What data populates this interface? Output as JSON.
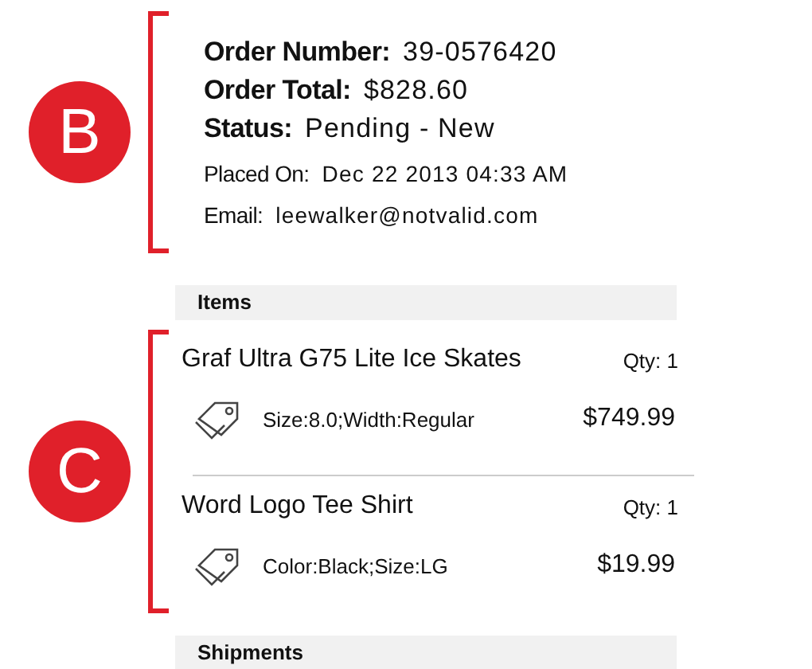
{
  "order": {
    "callout": "B",
    "summary": [
      {
        "label": "Order Number:",
        "value": "39-0576420"
      },
      {
        "label": "Order Total:",
        "value": "$828.60"
      },
      {
        "label": "Status:",
        "value": "Pending - New"
      }
    ],
    "details": [
      {
        "label": "Placed On:",
        "value": "Dec 22 2013 04:33 AM"
      },
      {
        "label": "Email:",
        "value": "leewalker@notvalid.com"
      }
    ]
  },
  "items": {
    "header": "Items",
    "callout": "C",
    "list": [
      {
        "name": "Graf Ultra G75 Lite Ice Skates",
        "qty": "Qty: 1",
        "options": "Size:8.0;Width:Regular",
        "price": "$749.99"
      },
      {
        "name": "Word Logo Tee Shirt",
        "qty": "Qty: 1",
        "options": "Color:Black;Size:LG",
        "price": "$19.99"
      }
    ]
  },
  "shipments": {
    "header": "Shipments"
  }
}
